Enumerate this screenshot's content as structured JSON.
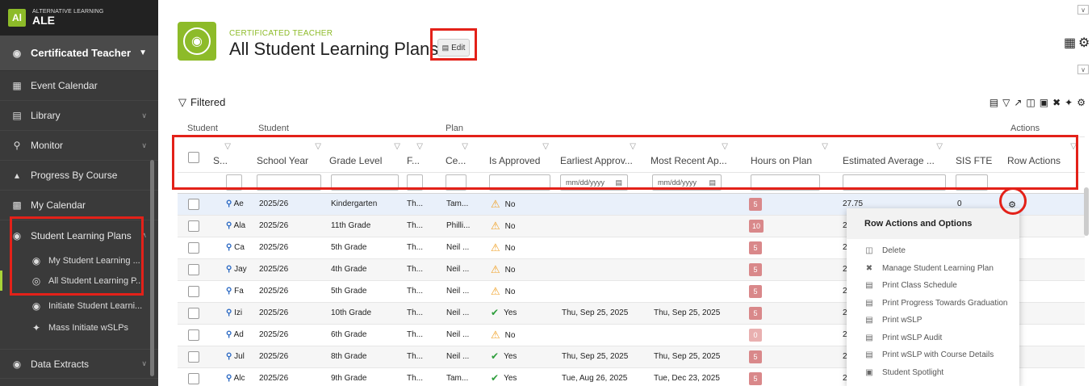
{
  "brand": {
    "small": "ALTERNATIVE LEARNING",
    "big": "ALE",
    "logo": "Al"
  },
  "role": {
    "label": "Certificated Teacher"
  },
  "nav": {
    "event_calendar": "Event Calendar",
    "library": "Library",
    "monitor": "Monitor",
    "progress_by_course": "Progress By Course",
    "my_calendar": "My Calendar",
    "student_learning_plans": "Student Learning Plans",
    "sub_my_slp": "My Student Learning ...",
    "sub_all_slp": "All Student Learning P...",
    "sub_initiate": "Initiate Student Learni...",
    "sub_mass": "Mass Initiate wSLPs",
    "data_extracts": "Data Extracts"
  },
  "header": {
    "subtitle": "CERTIFICATED TEACHER",
    "title": "All Student Learning Plans",
    "edit_label": "Edit"
  },
  "toolbar": {
    "filtered_label": "Filtered"
  },
  "grid": {
    "groups": {
      "student1": "Student",
      "student2": "Student",
      "plan": "Plan",
      "actions": "Actions"
    },
    "columns": {
      "s": "S...",
      "school_year": "School Year",
      "grade_level": "Grade Level",
      "f": "F...",
      "ce": "Ce...",
      "is_approved": "Is Approved",
      "earliest": "Earliest Approv...",
      "recent": "Most Recent Ap...",
      "hours": "Hours on Plan",
      "estimated": "Estimated Average ...",
      "sis_fte": "SIS FTE",
      "row_actions": "Row Actions"
    },
    "date_placeholder": "mm/dd/yyyy",
    "rows": [
      {
        "name": "Ae",
        "year": "2025/26",
        "grade": "Kindergarten",
        "f": "Th...",
        "ce": "Tam...",
        "approved": "No",
        "ok": false,
        "earliest": "",
        "recent": "",
        "hours": "5",
        "est": "27.75",
        "fte": "0"
      },
      {
        "name": "Ala",
        "year": "2025/26",
        "grade": "11th Grade",
        "f": "Th...",
        "ce": "Philli...",
        "approved": "No",
        "ok": false,
        "earliest": "",
        "recent": "",
        "hours": "10",
        "est": "2",
        "fte": ""
      },
      {
        "name": "Ca",
        "year": "2025/26",
        "grade": "5th Grade",
        "f": "Th...",
        "ce": "Neil ...",
        "approved": "No",
        "ok": false,
        "earliest": "",
        "recent": "",
        "hours": "5",
        "est": "2",
        "fte": ""
      },
      {
        "name": "Jay",
        "year": "2025/26",
        "grade": "4th Grade",
        "f": "Th...",
        "ce": "Neil ...",
        "approved": "No",
        "ok": false,
        "earliest": "",
        "recent": "",
        "hours": "5",
        "est": "2",
        "fte": ""
      },
      {
        "name": "Fa",
        "year": "2025/26",
        "grade": "5th Grade",
        "f": "Th...",
        "ce": "Neil ...",
        "approved": "No",
        "ok": false,
        "earliest": "",
        "recent": "",
        "hours": "5",
        "est": "2",
        "fte": ""
      },
      {
        "name": "Izi",
        "year": "2025/26",
        "grade": "10th Grade",
        "f": "Th...",
        "ce": "Neil ...",
        "approved": "Yes",
        "ok": true,
        "earliest": "Thu, Sep 25, 2025",
        "recent": "Thu, Sep 25, 2025",
        "hours": "5",
        "est": "2",
        "fte": ""
      },
      {
        "name": "Ad",
        "year": "2025/26",
        "grade": "6th Grade",
        "f": "Th...",
        "ce": "Neil ...",
        "approved": "No",
        "ok": false,
        "earliest": "",
        "recent": "",
        "hours": "0",
        "est": "2",
        "fte": ""
      },
      {
        "name": "Jul",
        "year": "2025/26",
        "grade": "8th Grade",
        "f": "Th...",
        "ce": "Neil ...",
        "approved": "Yes",
        "ok": true,
        "earliest": "Thu, Sep 25, 2025",
        "recent": "Thu, Sep 25, 2025",
        "hours": "5",
        "est": "2",
        "fte": ""
      },
      {
        "name": "Alc",
        "year": "2025/26",
        "grade": "9th Grade",
        "f": "Th...",
        "ce": "Tam...",
        "approved": "Yes",
        "ok": true,
        "earliest": "Tue, Aug 26, 2025",
        "recent": "Tue, Dec 23, 2025",
        "hours": "5",
        "est": "2",
        "fte": ""
      }
    ]
  },
  "menu": {
    "title": "Row Actions and Options",
    "items": [
      "Delete",
      "Manage Student Learning Plan",
      "Print Class Schedule",
      "Print Progress Towards Graduation",
      "Print wSLP",
      "Print wSLP Audit",
      "Print wSLP with Course Details",
      "Student Spotlight"
    ]
  },
  "colors": {
    "accent": "#8dbb29",
    "highlight": "#e32119",
    "hours_badge": "#d9888a"
  }
}
